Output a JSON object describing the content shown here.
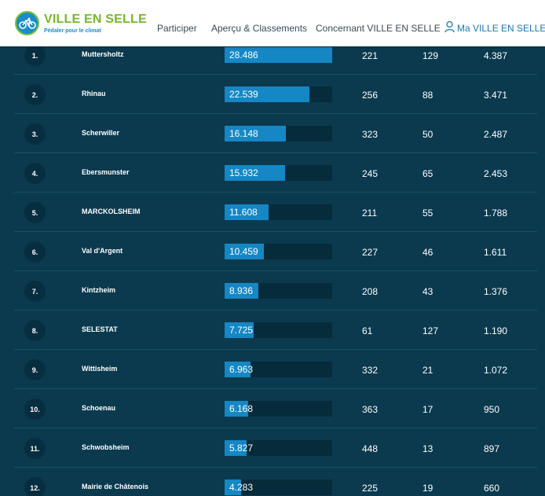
{
  "header": {
    "logo_title": "VILLE EN SELLE",
    "logo_subtitle": "Pédaler pour le climat",
    "nav": [
      "Participer",
      "Aperçu & Classements",
      "Concernant VILLE EN SELLE",
      "Ma VILLE EN SELLE"
    ]
  },
  "colors": {
    "background": "#0b3a4f",
    "bar": "#1587c5",
    "bar_track": "#062b3b",
    "logo_green": "#76b82a",
    "logo_blue": "#1b8cc6"
  },
  "rows": [
    {
      "rank": "1.",
      "name": "Muttersholtz",
      "value": "28.486",
      "col_a": "221",
      "col_b": "129",
      "col_c": "4.387",
      "fraction": 1.0
    },
    {
      "rank": "2.",
      "name": "Rhinau",
      "value": "22.539",
      "col_a": "256",
      "col_b": "88",
      "col_c": "3.471",
      "fraction": 0.791
    },
    {
      "rank": "3.",
      "name": "Scherwiller",
      "value": "16.148",
      "col_a": "323",
      "col_b": "50",
      "col_c": "2.487",
      "fraction": 0.567
    },
    {
      "rank": "4.",
      "name": "Ebersmunster",
      "value": "15.932",
      "col_a": "245",
      "col_b": "65",
      "col_c": "2.453",
      "fraction": 0.559
    },
    {
      "rank": "5.",
      "name": "MARCKOLSHEIM",
      "value": "11.608",
      "col_a": "211",
      "col_b": "55",
      "col_c": "1.788",
      "fraction": 0.407
    },
    {
      "rank": "6.",
      "name": "Val d'Argent",
      "value": "10.459",
      "col_a": "227",
      "col_b": "46",
      "col_c": "1.611",
      "fraction": 0.367
    },
    {
      "rank": "7.",
      "name": "Kintzheim",
      "value": "8.936",
      "col_a": "208",
      "col_b": "43",
      "col_c": "1.376",
      "fraction": 0.314
    },
    {
      "rank": "8.",
      "name": "SELESTAT",
      "value": "7.725",
      "col_a": "61",
      "col_b": "127",
      "col_c": "1.190",
      "fraction": 0.271
    },
    {
      "rank": "9.",
      "name": "Wittisheim",
      "value": "6.963",
      "col_a": "332",
      "col_b": "21",
      "col_c": "1.072",
      "fraction": 0.244
    },
    {
      "rank": "10.",
      "name": "Schoenau",
      "value": "6.168",
      "col_a": "363",
      "col_b": "17",
      "col_c": "950",
      "fraction": 0.217
    },
    {
      "rank": "11.",
      "name": "Schwobsheim",
      "value": "5.827",
      "col_a": "448",
      "col_b": "13",
      "col_c": "897",
      "fraction": 0.205
    },
    {
      "rank": "12.",
      "name": "Mairie de Châtenois",
      "value": "4.283",
      "col_a": "225",
      "col_b": "19",
      "col_c": "660",
      "fraction": 0.15
    }
  ]
}
